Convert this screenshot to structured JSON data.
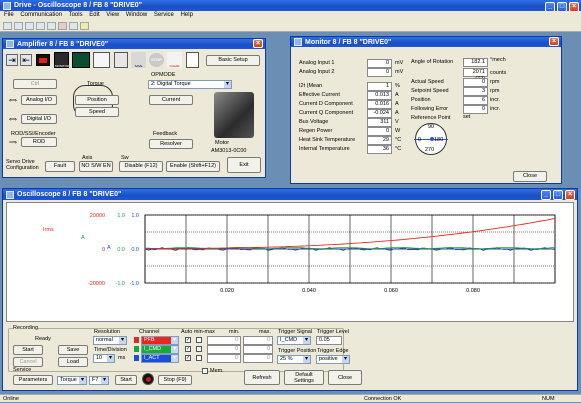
{
  "app": {
    "title": "Drive - Oscilloscope 8 / FB 8 \"DRIVE0\""
  },
  "menu": [
    "File",
    "Communication",
    "Tools",
    "Edit",
    "View",
    "Window",
    "Service",
    "Help"
  ],
  "amp": {
    "title": "Amplifier 8 / FB 8 \"DRIVE0\"",
    "toolbar": {
      "monitor": "MONITOR",
      "save": "SAVE",
      "stop": "STOP",
      "clear": "CLEAR",
      "basic_setup": "Basic Setup"
    },
    "opmode_label": "OPMODE",
    "opmode_value": "2: Digital Torque",
    "ctrl": "Ctrl",
    "torque": "Torque",
    "position": "Position",
    "speed": "Speed",
    "current": "Current",
    "analog_io": "Analog I/O",
    "digital_io": "Digital I/O",
    "rod_ssi": "ROD/SSI/Encoder",
    "rod": "ROD",
    "feedback": "Feedback",
    "resolver": "Resolver",
    "motor": "Motor",
    "motor_model": "AM3013-0C00",
    "servo_drive_config": "Servo Drive Configuration",
    "fault": "Fault",
    "axis": "Axis",
    "no_sw_en": "NO S/W EN",
    "sw": "Sw",
    "disable": "Disable (F12)",
    "enable": "Enable (Shift+F12)",
    "exit": "Exit"
  },
  "monitor": {
    "title": "Monitor 8 / FB 8 \"DRIVE0\"",
    "rows": [
      {
        "label": "Analog Input 1",
        "value": "0",
        "unit": "mV"
      },
      {
        "label": "Analog Input 2",
        "value": "0",
        "unit": "mV"
      },
      {
        "label": "I2t (Mean",
        "value": "1",
        "unit": "%"
      },
      {
        "label": "Effective Current",
        "value": "0.013",
        "unit": "A"
      },
      {
        "label": "Current D Component",
        "value": "0.016",
        "unit": "A"
      },
      {
        "label": "Current Q Component",
        "value": "-0.024",
        "unit": "A"
      },
      {
        "label": "Bus Voltage",
        "value": "311",
        "unit": "V"
      },
      {
        "label": "Regen Power",
        "value": "0",
        "unit": "W"
      },
      {
        "label": "Heat Sink Temperature",
        "value": "29",
        "unit": "°C"
      },
      {
        "label": "Internal Temperature",
        "value": "36",
        "unit": "°C"
      }
    ],
    "angle_label": "Angle of Rotation",
    "angle_value": "182.1",
    "angle_unit": "°mech",
    "counts_value": "2071 (72)",
    "counts_unit": "counts",
    "right_rows": [
      {
        "label": "Actual Speed",
        "value": "0",
        "unit": "rpm"
      },
      {
        "label": "Setpoint Speed",
        "value": "3",
        "unit": "rpm"
      },
      {
        "label": "Position",
        "value": "6",
        "unit": "incr."
      },
      {
        "label": "Following Error",
        "value": "0",
        "unit": "incr."
      },
      {
        "label": "Reference Point",
        "value": "set",
        "unit": ""
      }
    ],
    "dial": {
      "top": "90",
      "left": "0",
      "right": "180",
      "bottom": "270"
    },
    "close": "Close"
  },
  "scope": {
    "title": "Oscilloscope 8 / FB 8 \"DRIVE0\"",
    "y_red": [
      "20000",
      "0",
      "-20000"
    ],
    "y_green": [
      "1.0",
      "0.0",
      "-1.0"
    ],
    "y_blue": [
      "1.0",
      "0.0",
      "-1.0"
    ],
    "unit_red": "Irms",
    "unit_green": "A",
    "unit_blue": "A",
    "x_ticks": [
      "0.020",
      "0.040",
      "0.060",
      "0.080"
    ],
    "recording": "Recording",
    "status": "Ready",
    "start": "Start",
    "save": "Save",
    "cancel": "Cancel",
    "load": "Load",
    "resolution_label": "Resolution",
    "resolution_value": "normal",
    "time_div_label": "Time/Division",
    "time_div_value": "10",
    "time_div_unit": "ms",
    "channel_label": "Channel",
    "autominmax_label": "Auto min-max",
    "min_label": "min.",
    "max_label": "max.",
    "channels": [
      {
        "name": "PFB",
        "color": "#e8281e",
        "min": "0",
        "max": "0"
      },
      {
        "name": "I_CMD",
        "color": "#1aa83a",
        "min": "0",
        "max": "0"
      },
      {
        "name": "I_ACT",
        "color": "#1c4fd8",
        "min": "0",
        "max": "0"
      }
    ],
    "trigger_signal_label": "Trigger Signal",
    "trigger_signal_value": "I_CMD",
    "trigger_level_label": "Trigger Level",
    "trigger_level_value": "0.05",
    "trigger_position_label": "Trigger Position",
    "trigger_position_value": "25 %",
    "trigger_edge_label": "Trigger Edge",
    "trigger_edge_value": "positive",
    "service": "Service",
    "parameters": "Parameters",
    "service_mode": "Torque",
    "service_key": "F7",
    "service_start": "Start",
    "stop": "Stop (F9)",
    "mem": "Mem.",
    "refresh": "Refresh",
    "default_settings": "Default Settings",
    "close": "Close"
  },
  "statusbar": {
    "left": "Online",
    "conn": "Connection OK",
    "num": "NUM"
  }
}
